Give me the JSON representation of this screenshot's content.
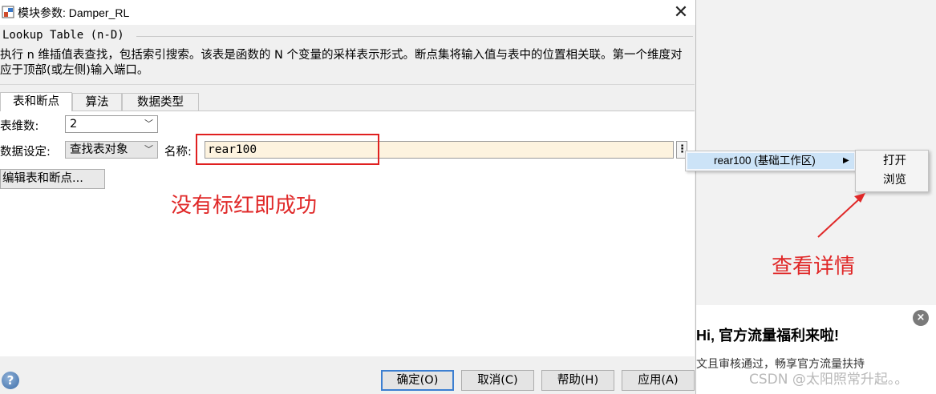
{
  "window": {
    "title": "模块参数: Damper_RL",
    "close_glyph": "✕"
  },
  "block": {
    "name": "Lookup Table (n-D)",
    "description": "执行 n 维插值表查找，包括索引搜索。该表是函数的 N 个变量的采样表示形式。断点集将输入值与表中的位置相关联。第一个维度对应于顶部(或左侧)输入端口。"
  },
  "tabs": [
    {
      "label": "表和断点",
      "active": true
    },
    {
      "label": "算法",
      "active": false
    },
    {
      "label": "数据类型",
      "active": false
    }
  ],
  "form": {
    "dims_label": "表维数:",
    "dims_value": "2",
    "spec_label": "数据设定:",
    "spec_value": "查找表对象",
    "name_label": "名称:",
    "name_value": "rear100",
    "more_glyph": "⋮",
    "edit_button": "编辑表和断点..."
  },
  "context_menu": {
    "item": "rear100 (基础工作区)",
    "submenu": [
      "打开",
      "浏览"
    ]
  },
  "annotations": {
    "success_note": "没有标红即成功",
    "details_note": "查看详情"
  },
  "buttons": {
    "help_glyph": "?",
    "ok": "确定(O)",
    "cancel": "取消(C)",
    "help": "帮助(H)",
    "apply": "应用(A)"
  },
  "promo": {
    "title": "Hi, 官方流量福利来啦!",
    "text": "文且审核通过，畅享官方流量扶持",
    "close_glyph": "×"
  },
  "watermark": "CSDN @太阳照常升起。。",
  "colors": {
    "annotation": "#e02828",
    "ok_border": "#3c7fd1",
    "name_field_bg": "#fdf3df",
    "menu_highlight": "#cce3f7"
  }
}
